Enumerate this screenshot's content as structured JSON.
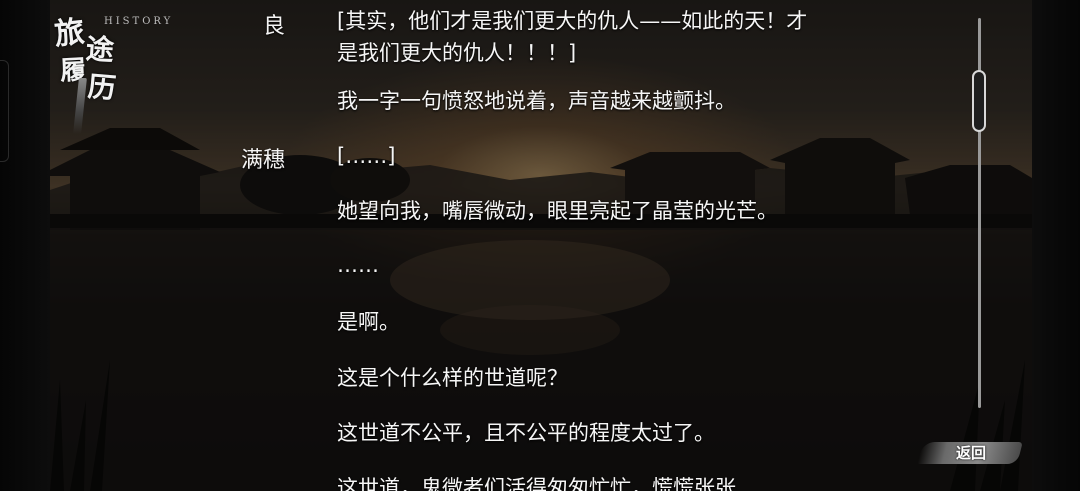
{
  "logo": {
    "chars": [
      "旅",
      "途",
      "履",
      "历"
    ],
    "subtitle": "HISTORY"
  },
  "entries": [
    {
      "speaker": "良",
      "lines": [
        "[其实，他们才是我们更大的仇人——如此的天！才",
        "是我们更大的仇人！！！]"
      ]
    },
    {
      "speaker": "",
      "lines": [
        "我一字一句愤怒地说着，声音越来越颤抖。"
      ]
    },
    {
      "speaker": "满穗",
      "lines": [
        "[……]"
      ]
    },
    {
      "speaker": "",
      "lines": [
        "她望向我，嘴唇微动，眼里亮起了晶莹的光芒。"
      ]
    },
    {
      "speaker": "",
      "lines": [
        "……"
      ]
    },
    {
      "speaker": "",
      "lines": [
        "是啊。"
      ]
    },
    {
      "speaker": "",
      "lines": [
        "这是个什么样的世道呢？"
      ]
    },
    {
      "speaker": "",
      "lines": [
        "这世道不公平，且不公平的程度太过了。"
      ]
    },
    {
      "speaker": "",
      "lines": [
        "这世道，鬼微者们活得匆匆忙忙，慌慌张张"
      ]
    }
  ],
  "back_button": {
    "label": "返回"
  },
  "colors": {
    "text": "#f6f6f6",
    "scrollbar": "#d8d8d8"
  }
}
